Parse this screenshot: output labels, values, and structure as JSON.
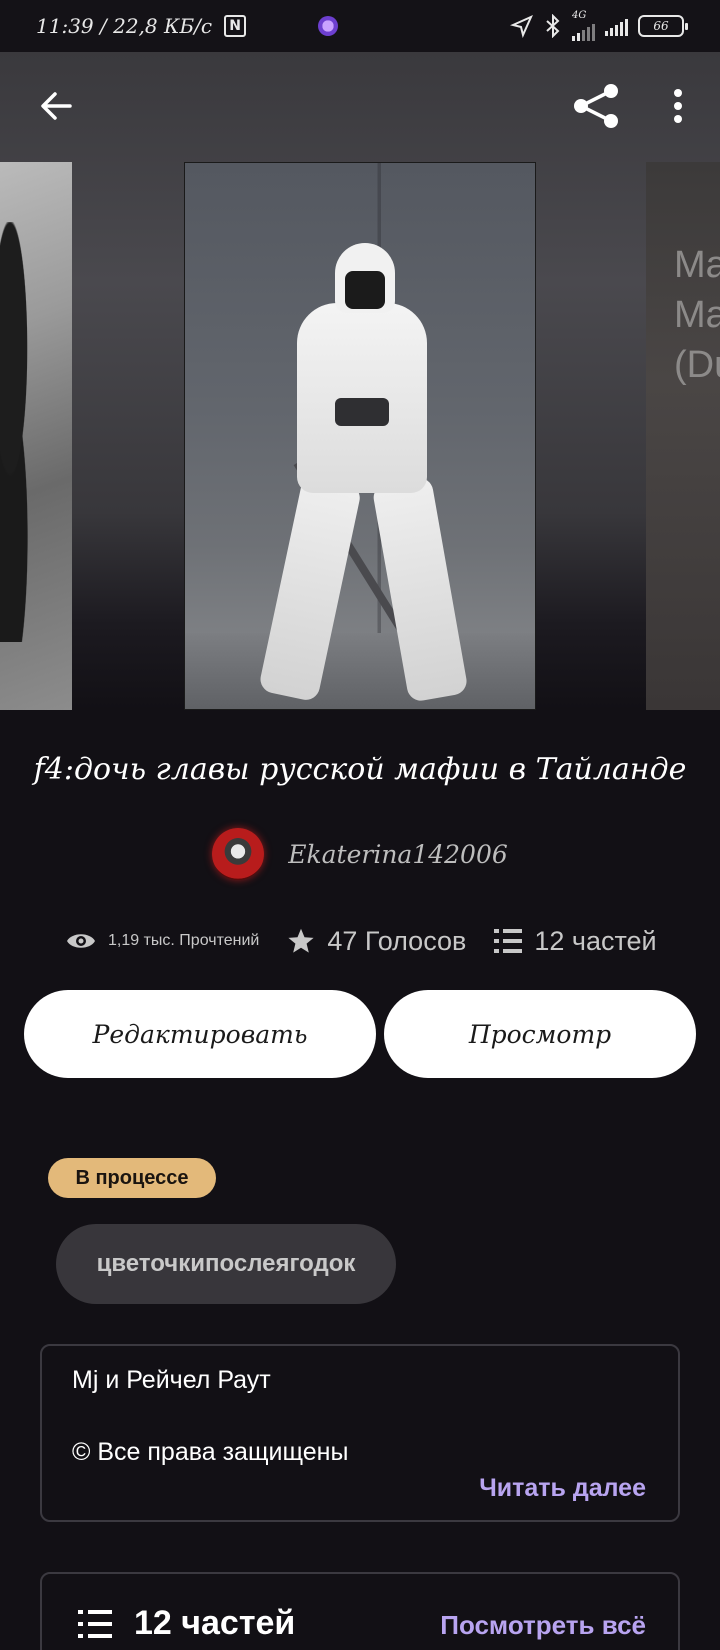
{
  "status_bar": {
    "time_speed": "11:39 / 22,8 КБ/с",
    "nfc_badge": "N",
    "network_label": "4G",
    "battery": "66"
  },
  "toolbar": {
    "back_icon": "arrow-left-icon",
    "share_icon": "share-icon",
    "more_icon": "more-vertical-icon"
  },
  "covers": {
    "right_cover_text": "Ma\nMa\n(Du"
  },
  "book": {
    "title": "f4:дочь главы  русской мафии в Тайланде",
    "author": "Ekaterina142006"
  },
  "stats": {
    "reads": "1,19 тыс. Прочтений",
    "votes": "47 Голосов",
    "parts": "12 частей"
  },
  "actions": {
    "edit_label": "Редактировать",
    "view_label": "Просмотр"
  },
  "status_pill": "В процессе",
  "tag": "цветочкипослеягодок",
  "description": {
    "line1": "Mj и Рейчел Раут",
    "line2": "© Все права защищены",
    "read_more": "Читать далее"
  },
  "parts_section": {
    "count_label": "12 частей",
    "see_all": "Посмотреть всё"
  },
  "colors": {
    "background": "#121015",
    "accent": "#b8a4f0",
    "status_pill": "#e3b97a"
  }
}
